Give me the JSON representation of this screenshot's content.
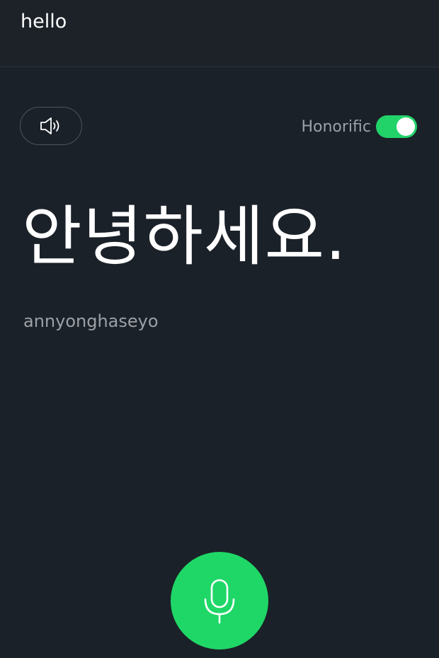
{
  "source": {
    "text": "hello"
  },
  "controls": {
    "speaker_icon": "speaker-icon",
    "honorific_label": "Honorific",
    "honorific_on": true,
    "accent_color": "#22d36a"
  },
  "result": {
    "translation": "안녕하세요.",
    "romanization": "annyonghaseyo"
  },
  "mic": {
    "icon": "microphone-icon",
    "color": "#1fd767"
  },
  "colors": {
    "background": "#1b2128",
    "secondary_text": "#9ba1a6"
  }
}
